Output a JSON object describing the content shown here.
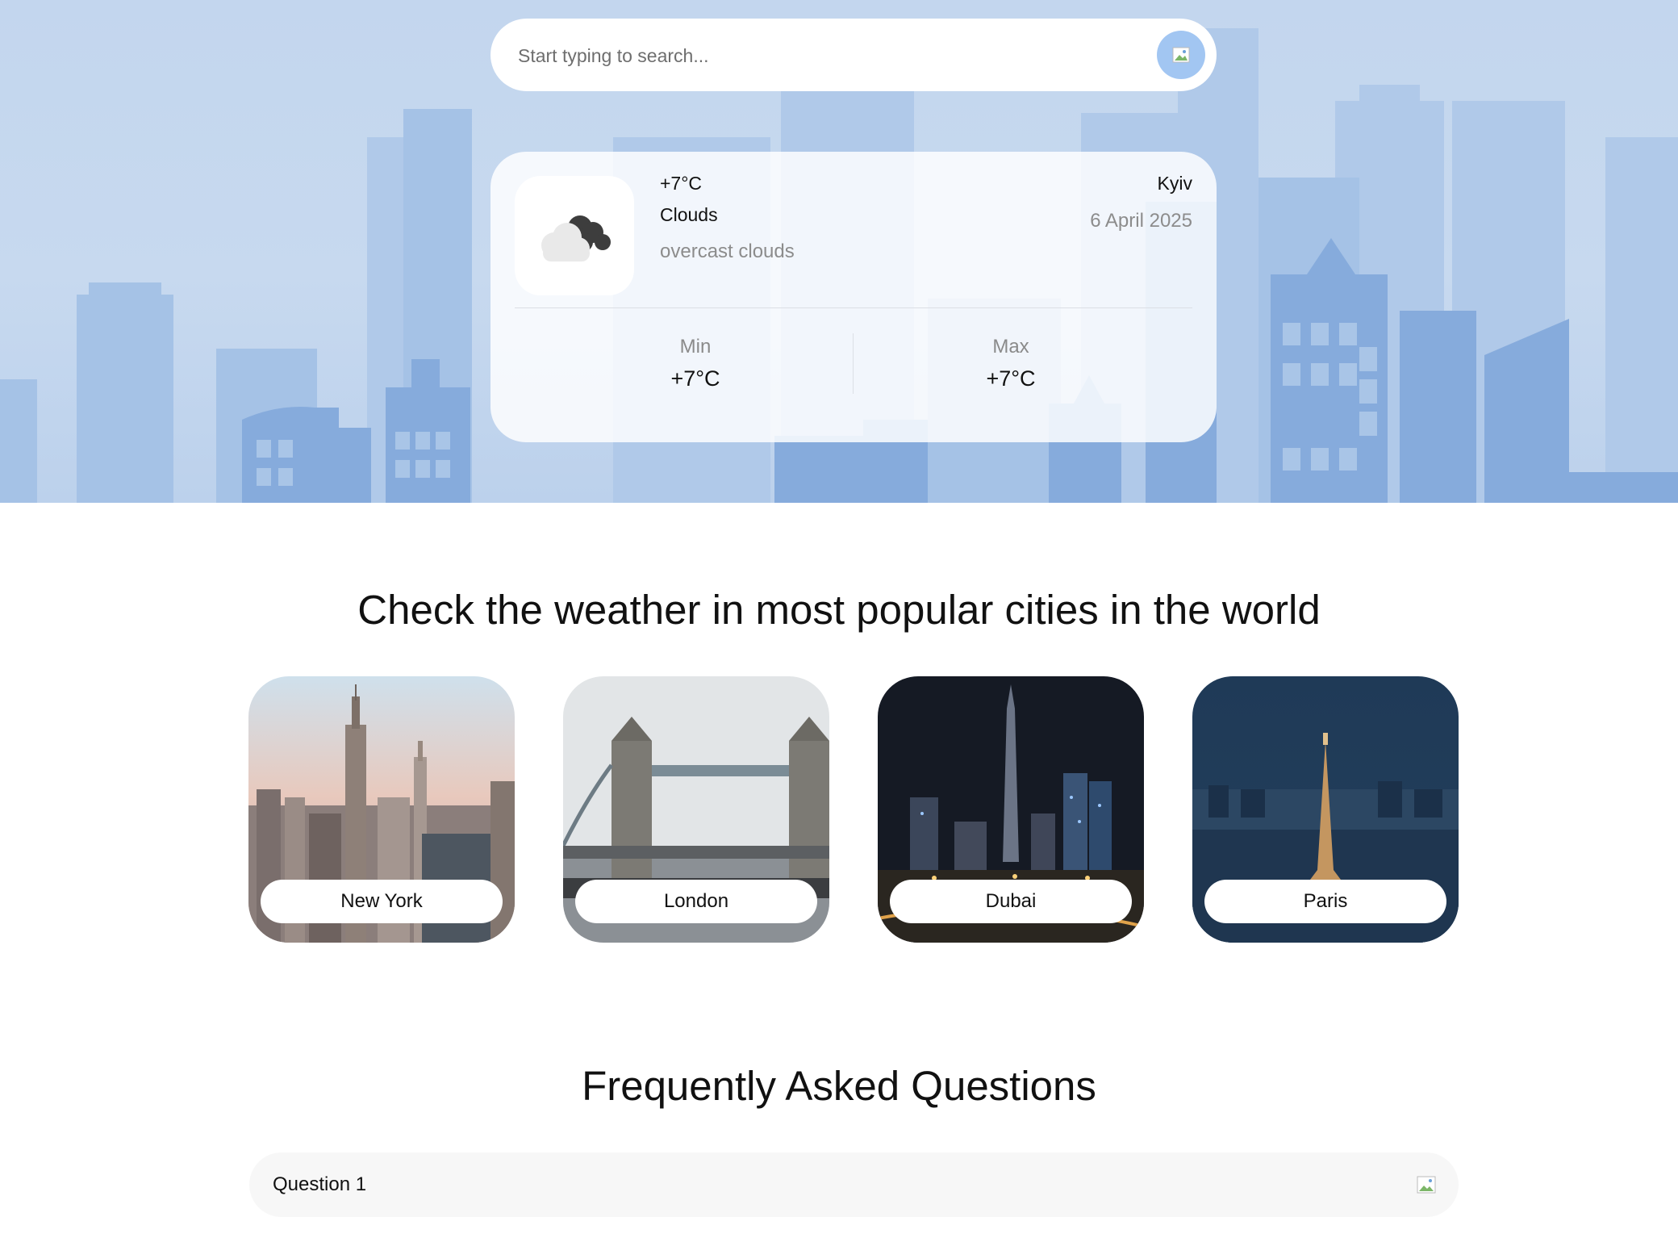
{
  "search": {
    "placeholder": "Start typing to search..."
  },
  "current": {
    "temperature": "+7°C",
    "condition": "Clouds",
    "description": "overcast clouds",
    "city": "Kyiv",
    "date": "6 April 2025",
    "min_label": "Min",
    "min_value": "+7°C",
    "max_label": "Max",
    "max_value": "+7°C",
    "icon": "cloud-icon"
  },
  "popular": {
    "title": "Check the weather in most popular cities in the world",
    "cities": [
      {
        "name": "New York"
      },
      {
        "name": "London"
      },
      {
        "name": "Dubai"
      },
      {
        "name": "Paris"
      }
    ]
  },
  "faq": {
    "title": "Frequently Asked Questions",
    "items": [
      {
        "question": "Question 1"
      }
    ]
  },
  "colors": {
    "search_button": "#a2c6f2",
    "sky": "#c3d6ee",
    "buildings": "#7fa6d8"
  }
}
